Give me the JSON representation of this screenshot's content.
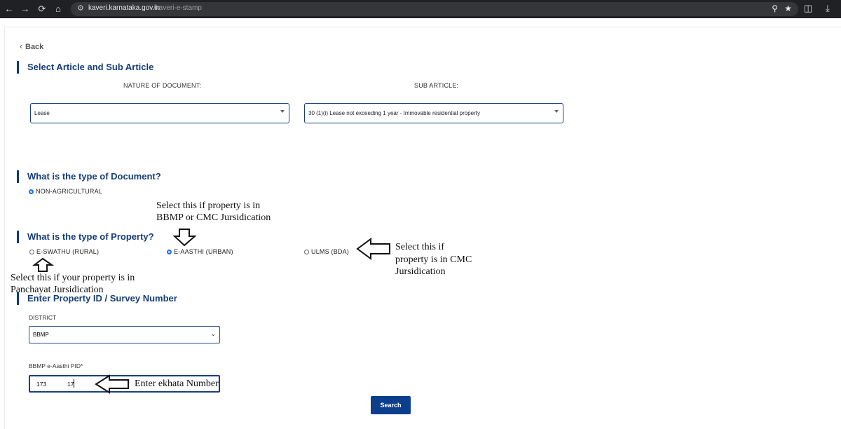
{
  "browser": {
    "url_host": "kaveri.karnataka.gov.in",
    "url_path": "/kaveri-e-stamp"
  },
  "page": {
    "back_label": "Back",
    "section1": {
      "title": "Select Article and Sub Article",
      "nature_label": "NATURE OF DOCUMENT:",
      "nature_value": "Lease",
      "sub_label": "SUB ARTICLE:",
      "sub_value": "30 (1)(i) Lease not exceeding 1 year - Immovable residential property"
    },
    "section2": {
      "title": "What is the type of Document?",
      "option": "NON-AGRICULTURAL"
    },
    "section3": {
      "title": "What is the type of Property?",
      "options": [
        "E-SWATHU (RURAL)",
        "E-AASTHI (URBAN)",
        "ULMS (BDA)"
      ],
      "selected": "E-AASTHI (URBAN)"
    },
    "section4": {
      "title": "Enter Property ID / Survey Number",
      "district_label": "DISTRICT",
      "district_value": "BBMP",
      "pid_label": "BBMP e-Aasthi PID*",
      "pid_value_part1": "173",
      "pid_value_part2": "17",
      "search_label": "Search"
    }
  },
  "annotations": {
    "urban_line1": "Select this if property is in",
    "urban_line2": "BBMP or CMC Jursidication",
    "ulms_line1": "Select this if",
    "ulms_line2": "property is in CMC",
    "ulms_line3": "Jursidication",
    "rural_line1": "Select this if your property is in",
    "rural_line2": "Panchayat Jursidication",
    "pid_note": "Enter ekhata Number"
  }
}
